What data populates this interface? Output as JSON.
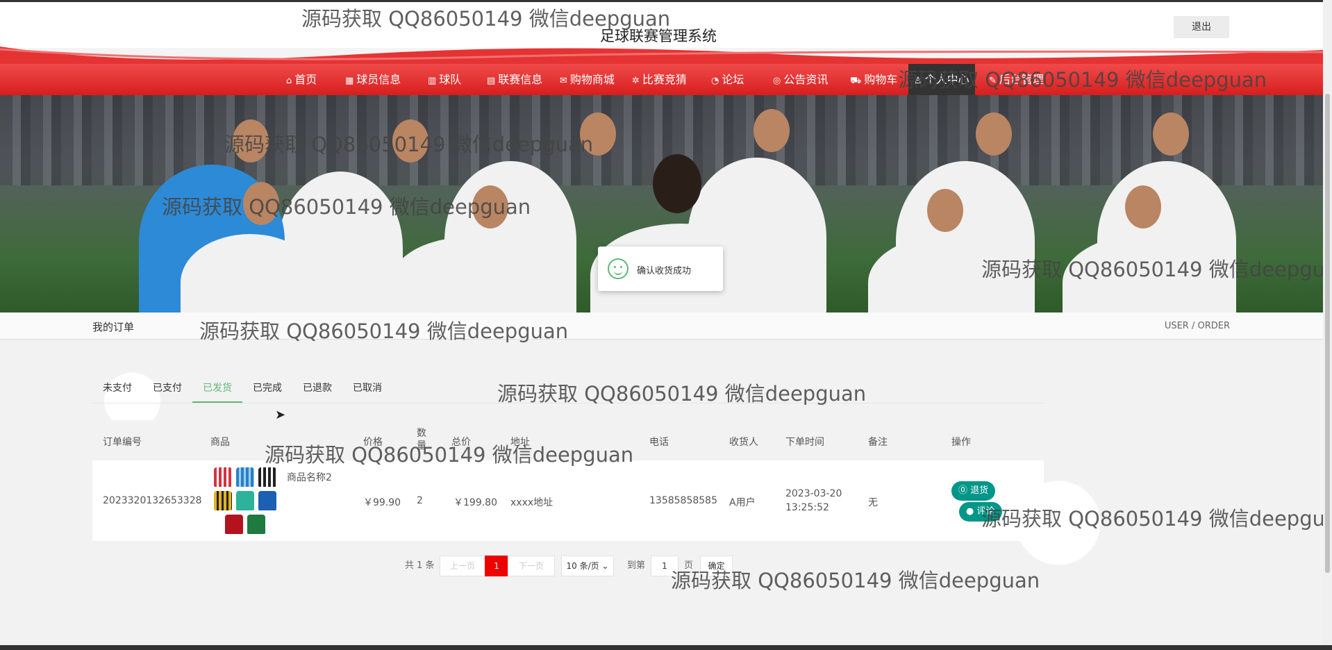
{
  "site": {
    "title": "足球联赛管理系统",
    "logout_label": "退出"
  },
  "nav": {
    "items": [
      {
        "icon": "⌂",
        "label": "首页"
      },
      {
        "icon": "▦",
        "label": "球员信息"
      },
      {
        "icon": "▥",
        "label": "球队"
      },
      {
        "icon": "▤",
        "label": "联赛信息"
      },
      {
        "icon": "✉",
        "label": "购物商城"
      },
      {
        "icon": "✲",
        "label": "比赛竞猜"
      },
      {
        "icon": "◔",
        "label": "论坛"
      },
      {
        "icon": "◎",
        "label": "公告资讯"
      },
      {
        "icon": "⛟",
        "label": "购物车"
      },
      {
        "icon": "♙",
        "label": "个人中心"
      },
      {
        "icon": "✎",
        "label": "后台管理"
      }
    ]
  },
  "toast": {
    "message": "确认收货成功"
  },
  "breadcrumb": {
    "title": "我的订单",
    "right": "USER / ORDER"
  },
  "tabs": [
    "未支付",
    "已支付",
    "已发货",
    "已完成",
    "已退款",
    "已取消"
  ],
  "table": {
    "headers": [
      "订单编号",
      "商品",
      "价格",
      "数量",
      "总价",
      "地址",
      "电话",
      "收货人",
      "下单时间",
      "备注",
      "操作"
    ],
    "rows": [
      {
        "order_no": "2023320132653328",
        "product_name": "商品名称2",
        "price": "￥99.90",
        "qty": "2",
        "total": "￥199.80",
        "address": "xxxx地址",
        "phone": "13585858585",
        "receiver": "A用户",
        "date": "2023-03-20",
        "time": "13:25:52",
        "note": "无",
        "btn_refund": "退货",
        "btn_comment": "评论"
      }
    ]
  },
  "pager": {
    "total": "共 1 条",
    "prev": "上一页",
    "current": "1",
    "next": "下一页",
    "page_size": "10 条/页",
    "goto_label": "到第",
    "goto_value": "1",
    "page_unit": "页",
    "confirm": "确定"
  },
  "watermark": "源码获取 QQ86050149 微信deepguan",
  "colors": {
    "nav_red": "#e53333",
    "active_green": "#5fb878",
    "button_teal": "#009688",
    "page_red": "#ee0000"
  }
}
